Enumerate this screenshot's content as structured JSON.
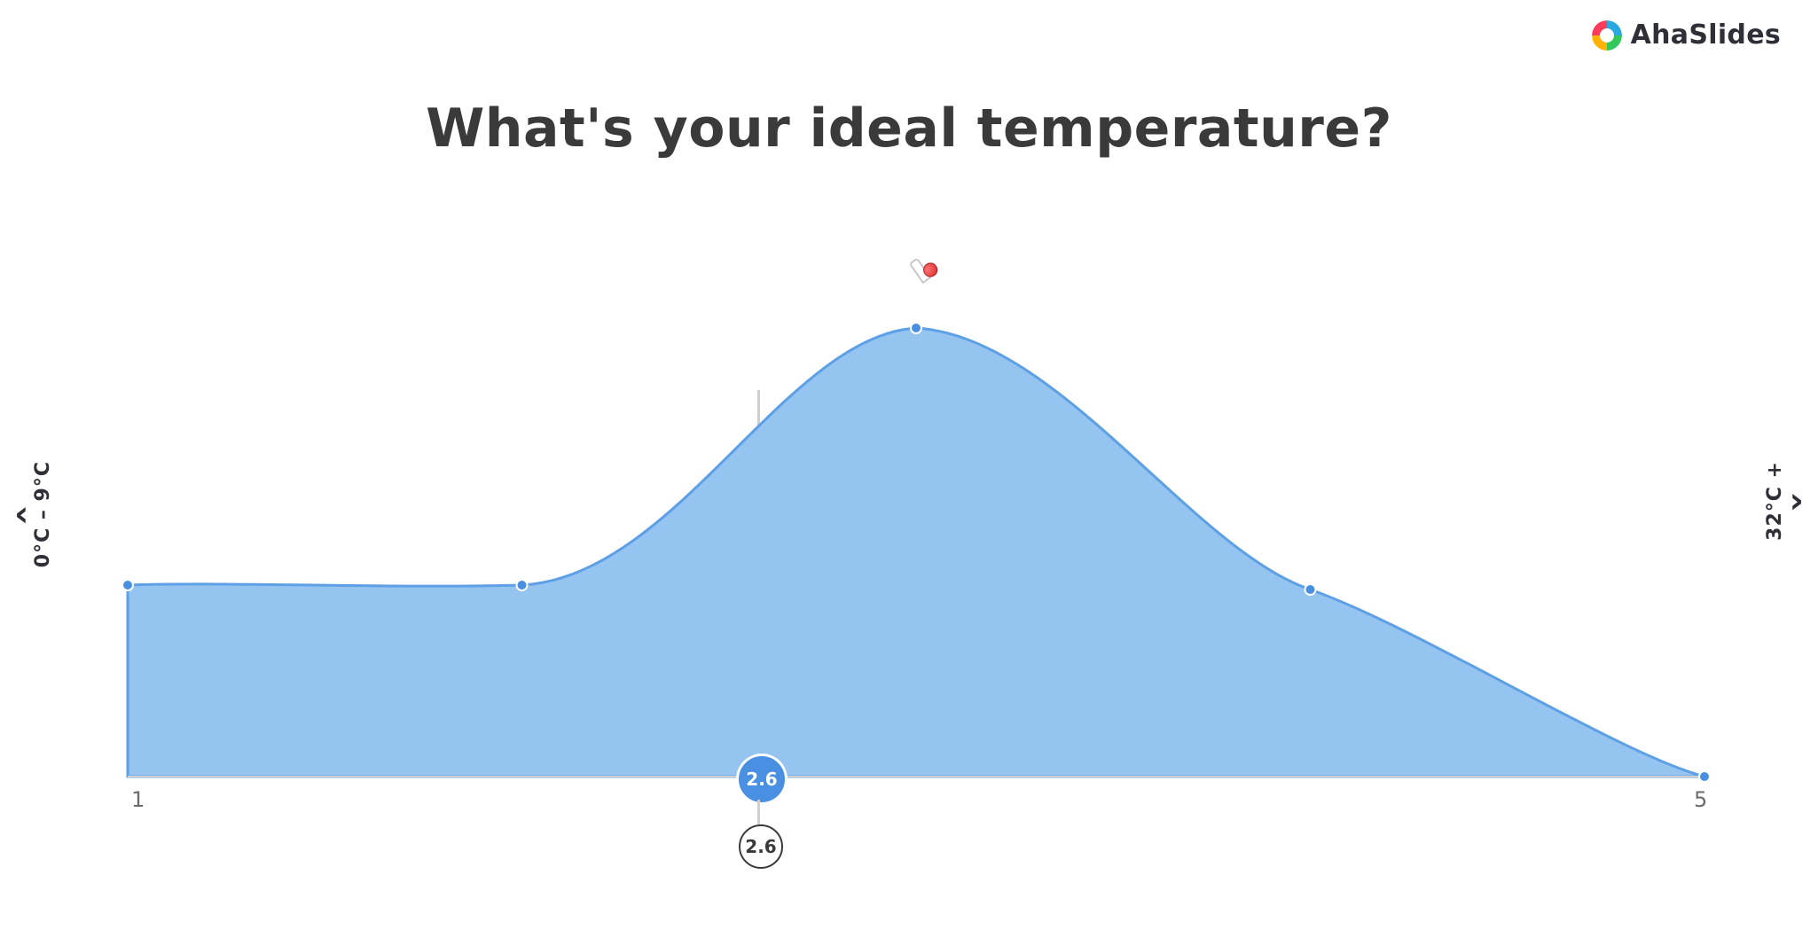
{
  "brand": {
    "text": "AhaSlides"
  },
  "title": "What's your ideal temperature?",
  "left_label": "0°C – 9°C",
  "right_label": "32°C +",
  "average_badge": "2.6",
  "average_badge_outline": "2.6",
  "xticks": {
    "min": "1",
    "max": "5"
  },
  "colors": {
    "area_fill": "#96c4f0",
    "area_stroke": "#5ea0e6",
    "point_fill": "#4a90e2",
    "badge_fill": "#4a90e2"
  },
  "thermometer_icon": "thermometer-icon",
  "nav": {
    "prev": "‹",
    "next": "›"
  },
  "chart_data": {
    "type": "area",
    "title": "What's your ideal temperature?",
    "xlabel": "",
    "ylabel": "",
    "xlim": [
      1,
      5
    ],
    "ylim": [
      0,
      1
    ],
    "x": [
      1,
      2,
      3,
      4,
      5
    ],
    "values": [
      0.35,
      0.35,
      1.0,
      0.35,
      0.0
    ],
    "average": 2.6,
    "end_labels": {
      "left": "0°C – 9°C",
      "right": "32°C +"
    },
    "annotations": [
      {
        "text": "2.6",
        "x": 2.6,
        "style": "badge-filled"
      },
      {
        "text": "2.6",
        "x": 2.6,
        "style": "badge-outline"
      }
    ]
  }
}
